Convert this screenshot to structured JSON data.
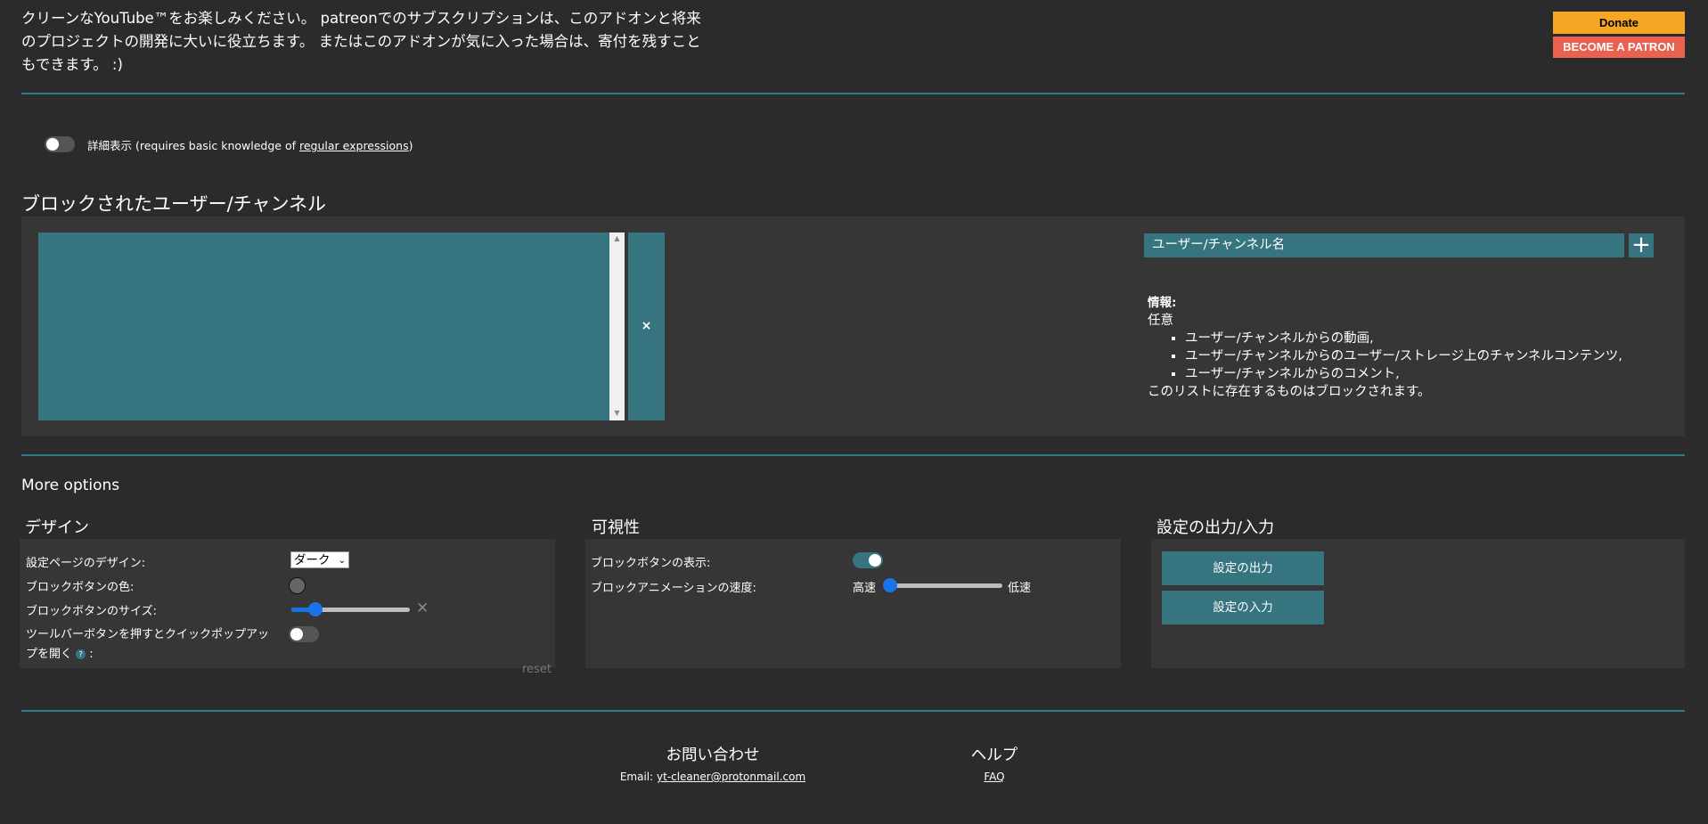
{
  "header": {
    "intro_text": "クリーンなYouTube™をお楽しみください。 patreonでのサブスクリプションは、このアドオンと将来のプロジェクトの開発に大いに役立ちます。 またはこのアドオンが気に入った場合は、寄付を残すこともできます。 :)",
    "donate_label": "Donate",
    "patron_label": "BECOME A PATRON"
  },
  "advanced": {
    "label": "詳細表示",
    "note_prefix": "(requires basic knowledge of ",
    "link_text": "regular expressions",
    "note_suffix": ")",
    "enabled": false
  },
  "blocked": {
    "title": "ブロックされたユーザー/チャンネル",
    "items": [],
    "remove_label": "×",
    "input_placeholder": "ユーザー/チャンネル名",
    "add_label": "+",
    "info_title": "情報:",
    "info_intro": "任意",
    "info_items": [
      "ユーザー/チャンネルからの動画,",
      "ユーザー/チャンネルからのユーザー/ストレージ上のチャンネルコンテンツ,",
      "ユーザー/チャンネルからのコメント,"
    ],
    "info_outro": "このリストに存在するものはブロックされます。"
  },
  "more_options": {
    "title": "More options",
    "design": {
      "title": "デザイン",
      "page_design_label": "設定ページのデザイン:",
      "page_design_value": "ダーク",
      "button_color_label": "ブロックボタンの色:",
      "button_color": "#666666",
      "button_size_label": "ブロックボタンのサイズ:",
      "button_size_value": 0.2,
      "quick_popup_label_1": "ツールバーボタンを押すとクイックポップアッ",
      "quick_popup_label_2": "プを開く",
      "quick_popup_help": "?",
      "quick_popup_colon": ":",
      "quick_popup_enabled": false,
      "reset_label": "reset"
    },
    "visibility": {
      "title": "可視性",
      "show_button_label": "ブロックボタンの表示:",
      "show_button_enabled": true,
      "anim_speed_label": "ブロックアニメーションの速度:",
      "anim_fast": "高速",
      "anim_slow": "低速",
      "anim_speed_value": 0.05
    },
    "export": {
      "title": "設定の出力/入力",
      "export_label": "設定の出力",
      "import_label": "設定の入力"
    }
  },
  "footer": {
    "contact_title": "お問い合わせ",
    "email_prefix": "Email: ",
    "email": "yt-cleaner@protonmail.com",
    "help_title": "ヘルプ",
    "faq_label": "FAQ"
  },
  "colors": {
    "accent": "#367480",
    "background": "#2b2b2b",
    "panel": "#363636",
    "donate": "#f5a623",
    "patron": "#e8624f"
  }
}
